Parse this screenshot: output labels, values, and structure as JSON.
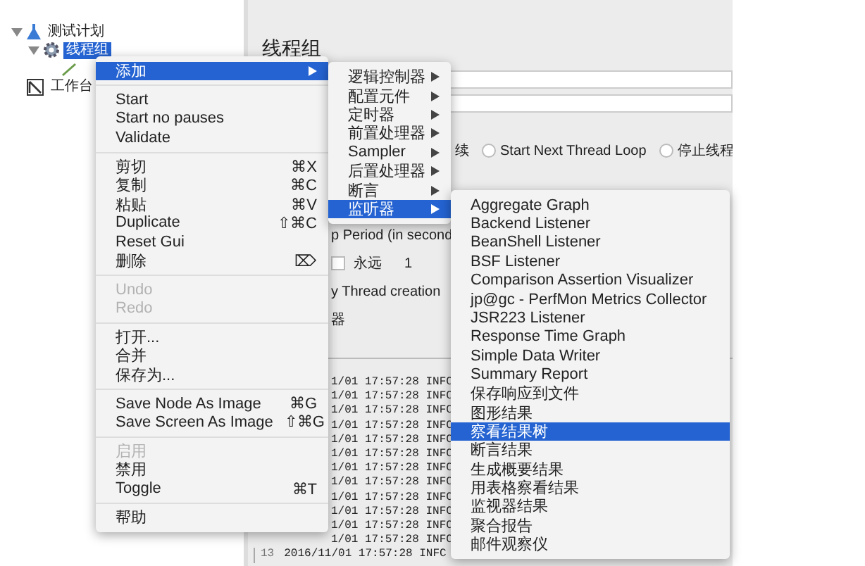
{
  "tree": [
    {
      "kind": "plan",
      "label": "测试计划",
      "expanded": true,
      "selected": false,
      "children": [
        {
          "kind": "thread_group",
          "label": "线程组",
          "expanded": true,
          "selected": true,
          "children": [
            {
              "kind": "element"
            }
          ]
        }
      ]
    },
    {
      "kind": "workbench",
      "label": "工作台",
      "selected": false
    }
  ],
  "panel": {
    "title": "线程组",
    "radio_options": [
      {
        "label": "续"
      },
      {
        "label": "Start Next Thread Loop",
        "selected": false
      },
      {
        "label": "停止线程",
        "selected": false
      }
    ],
    "ramp_label": "p Period (in second",
    "loop": {
      "label": "永远",
      "checked": false,
      "value": "1"
    },
    "delay_label": "y Thread creation",
    "section_label": "器",
    "log_lines": [
      {
        "text": "1/01 17:57:28 INFC"
      },
      {
        "text": "1/01 17:57:28 INFC"
      },
      {
        "text": "1/01 17:57:28 INFC"
      },
      {
        "text": "1/01 17:57:28 INFC"
      },
      {
        "text": "1/01 17:57:28 INFC"
      },
      {
        "text": "1/01 17:57:28 INFC"
      },
      {
        "text": "1/01 17:57:28 INFC"
      },
      {
        "text": "1/01 17:57:28 INFC"
      },
      {
        "text": "1/01 17:57:28 INFC"
      },
      {
        "text": "1/01 17:57:28 INFC"
      },
      {
        "text": "1/01 17:57:28 INFC"
      },
      {
        "text": "1/01 17:57:28 INFC"
      },
      {
        "line_number": "13",
        "text": "2016/11/01 17:57:28 INFC"
      }
    ]
  },
  "context_menu": [
    {
      "kind": "item",
      "label": "添加",
      "submenu": true,
      "selected": true,
      "disabled": false
    },
    {
      "kind": "separator"
    },
    {
      "kind": "item",
      "label": "Start",
      "selected": false,
      "disabled": false
    },
    {
      "kind": "item",
      "label": "Start no pauses",
      "selected": false,
      "disabled": false
    },
    {
      "kind": "item",
      "label": "Validate",
      "selected": false,
      "disabled": false
    },
    {
      "kind": "separator"
    },
    {
      "kind": "item",
      "label": "剪切",
      "shortcut": "⌘X",
      "selected": false,
      "disabled": false
    },
    {
      "kind": "item",
      "label": "复制",
      "shortcut": "⌘C",
      "selected": false,
      "disabled": false
    },
    {
      "kind": "item",
      "label": "粘贴",
      "shortcut": "⌘V",
      "selected": false,
      "disabled": false
    },
    {
      "kind": "item",
      "label": "Duplicate",
      "shortcut": "⇧⌘C",
      "selected": false,
      "disabled": false
    },
    {
      "kind": "item",
      "label": "Reset Gui",
      "selected": false,
      "disabled": false
    },
    {
      "kind": "item",
      "label": "删除",
      "shortcut": "⌦",
      "selected": false,
      "disabled": false
    },
    {
      "kind": "separator"
    },
    {
      "kind": "item",
      "label": "Undo",
      "selected": false,
      "disabled": true
    },
    {
      "kind": "item",
      "label": "Redo",
      "selected": false,
      "disabled": true
    },
    {
      "kind": "separator"
    },
    {
      "kind": "item",
      "label": "打开...",
      "selected": false,
      "disabled": false
    },
    {
      "kind": "item",
      "label": "合并",
      "selected": false,
      "disabled": false
    },
    {
      "kind": "item",
      "label": "保存为...",
      "selected": false,
      "disabled": false
    },
    {
      "kind": "separator"
    },
    {
      "kind": "item",
      "label": "Save Node As Image",
      "shortcut": "⌘G",
      "selected": false,
      "disabled": false
    },
    {
      "kind": "item",
      "label": "Save Screen As Image",
      "shortcut": "⇧⌘G",
      "selected": false,
      "disabled": false
    },
    {
      "kind": "separator"
    },
    {
      "kind": "item",
      "label": "启用",
      "selected": false,
      "disabled": true
    },
    {
      "kind": "item",
      "label": "禁用",
      "selected": false,
      "disabled": false
    },
    {
      "kind": "item",
      "label": "Toggle",
      "shortcut": "⌘T",
      "selected": false,
      "disabled": false
    },
    {
      "kind": "separator"
    },
    {
      "kind": "item",
      "label": "帮助",
      "selected": false,
      "disabled": false
    }
  ],
  "add_submenu": [
    {
      "kind": "item",
      "label": "逻辑控制器",
      "submenu": true,
      "selected": false,
      "disabled": false
    },
    {
      "kind": "item",
      "label": "配置元件",
      "submenu": true,
      "selected": false,
      "disabled": false
    },
    {
      "kind": "item",
      "label": "定时器",
      "submenu": true,
      "selected": false,
      "disabled": false
    },
    {
      "kind": "item",
      "label": "前置处理器",
      "submenu": true,
      "selected": false,
      "disabled": false
    },
    {
      "kind": "item",
      "label": "Sampler",
      "submenu": true,
      "selected": false,
      "disabled": false
    },
    {
      "kind": "item",
      "label": "后置处理器",
      "submenu": true,
      "selected": false,
      "disabled": false
    },
    {
      "kind": "item",
      "label": "断言",
      "submenu": true,
      "selected": false,
      "disabled": false
    },
    {
      "kind": "item",
      "label": "监听器",
      "submenu": true,
      "selected": true,
      "disabled": false
    }
  ],
  "listener_submenu": [
    {
      "kind": "item",
      "label": "Aggregate Graph",
      "selected": false,
      "disabled": false
    },
    {
      "kind": "item",
      "label": "Backend Listener",
      "selected": false,
      "disabled": false
    },
    {
      "kind": "item",
      "label": "BeanShell Listener",
      "selected": false,
      "disabled": false
    },
    {
      "kind": "item",
      "label": "BSF Listener",
      "selected": false,
      "disabled": false
    },
    {
      "kind": "item",
      "label": "Comparison Assertion Visualizer",
      "selected": false,
      "disabled": false
    },
    {
      "kind": "item",
      "label": "jp@gc - PerfMon Metrics Collector",
      "selected": false,
      "disabled": false
    },
    {
      "kind": "item",
      "label": "JSR223 Listener",
      "selected": false,
      "disabled": false
    },
    {
      "kind": "item",
      "label": "Response Time Graph",
      "selected": false,
      "disabled": false
    },
    {
      "kind": "item",
      "label": "Simple Data Writer",
      "selected": false,
      "disabled": false
    },
    {
      "kind": "item",
      "label": "Summary Report",
      "selected": false,
      "disabled": false
    },
    {
      "kind": "item",
      "label": "保存响应到文件",
      "selected": false,
      "disabled": false
    },
    {
      "kind": "item",
      "label": "图形结果",
      "selected": false,
      "disabled": false
    },
    {
      "kind": "item",
      "label": "察看结果树",
      "selected": true,
      "disabled": false
    },
    {
      "kind": "item",
      "label": "断言结果",
      "selected": false,
      "disabled": false
    },
    {
      "kind": "item",
      "label": "生成概要结果",
      "selected": false,
      "disabled": false
    },
    {
      "kind": "item",
      "label": "用表格察看结果",
      "selected": false,
      "disabled": false
    },
    {
      "kind": "item",
      "label": "监视器结果",
      "selected": false,
      "disabled": false
    },
    {
      "kind": "item",
      "label": "聚合报告",
      "selected": false,
      "disabled": false
    },
    {
      "kind": "item",
      "label": "邮件观察仪",
      "selected": false,
      "disabled": false
    }
  ]
}
